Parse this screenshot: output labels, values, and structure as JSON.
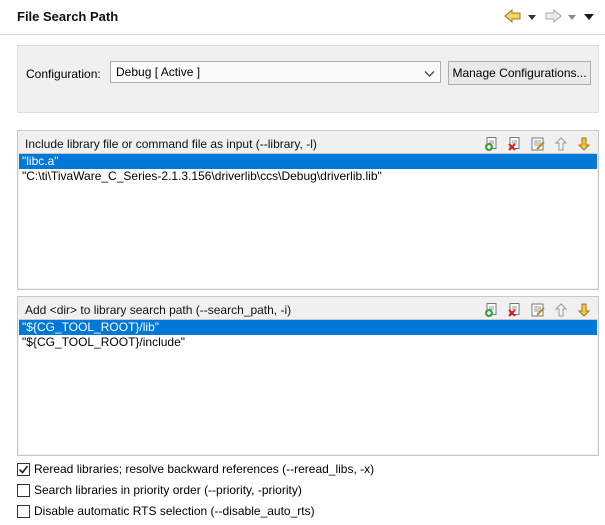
{
  "header": {
    "title": "File Search Path",
    "nav": {
      "back_icon": "back-arrow-icon",
      "forward_icon": "forward-arrow-icon",
      "menu_icon": "view-menu-icon"
    }
  },
  "configuration": {
    "label": "Configuration:",
    "selected": "Debug  [ Active ]",
    "manage_button": "Manage Configurations..."
  },
  "library_group": {
    "title": "Include library file or command file as input (--library, -l)",
    "items": [
      "\"libc.a\"",
      "\"C:\\ti\\TivaWare_C_Series-2.1.3.156\\driverlib\\ccs\\Debug\\driverlib.lib\""
    ],
    "selected_index": 0,
    "toolbar": [
      "add-icon",
      "delete-icon",
      "edit-icon",
      "move-up-icon",
      "move-down-icon"
    ]
  },
  "search_path_group": {
    "title": "Add <dir> to library search path (--search_path, -i)",
    "items": [
      "\"${CG_TOOL_ROOT}/lib\"",
      "\"${CG_TOOL_ROOT}/include\""
    ],
    "selected_index": 0,
    "toolbar": [
      "add-icon",
      "delete-icon",
      "edit-icon",
      "move-up-icon",
      "move-down-icon"
    ]
  },
  "options": [
    {
      "label": "Reread libraries; resolve backward references (--reread_libs, -x)",
      "checked": true
    },
    {
      "label": "Search libraries in priority order (--priority, -priority)",
      "checked": false
    },
    {
      "label": "Disable automatic RTS selection (--disable_auto_rts)",
      "checked": false
    }
  ],
  "colors": {
    "selection": "#0078d7",
    "panel_bg": "#f0f0f0",
    "nav_arrow": "#f0c040"
  }
}
